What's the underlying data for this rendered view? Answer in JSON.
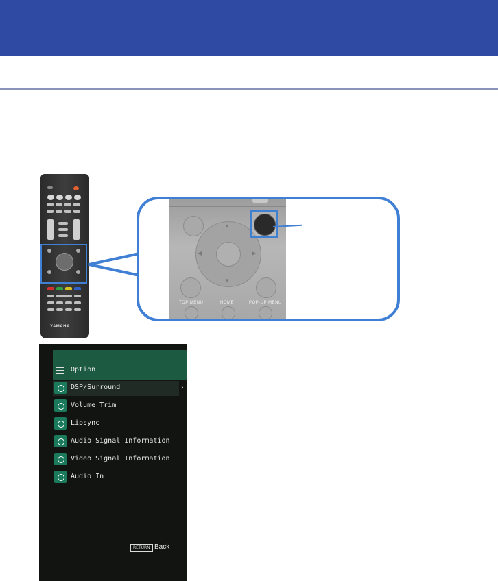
{
  "remote": {
    "brand": "YAMAHA",
    "zoom_labels": {
      "top_menu": "TOP MENU",
      "home": "HOME",
      "popup_menu": "POP-UP MENU"
    }
  },
  "menu": {
    "title": "Option",
    "items": [
      {
        "label": "DSP/Surround",
        "icon": "dsp-surround-icon",
        "selected": true
      },
      {
        "label": "Volume Trim",
        "icon": "volume-trim-icon"
      },
      {
        "label": "Lipsync",
        "icon": "lipsync-icon"
      },
      {
        "label": "Audio Signal Information",
        "icon": "audio-info-icon"
      },
      {
        "label": "Video Signal Information",
        "icon": "video-info-icon"
      },
      {
        "label": "Audio In",
        "icon": "audio-in-icon"
      }
    ],
    "chevron": "›",
    "return_key": "RETURN",
    "back_label": "Back"
  },
  "colors": {
    "header": "#2e4aa3",
    "callout": "#3f7fd4",
    "menu_header": "#1c5a41",
    "icon_bg": "#1b7a5c"
  }
}
